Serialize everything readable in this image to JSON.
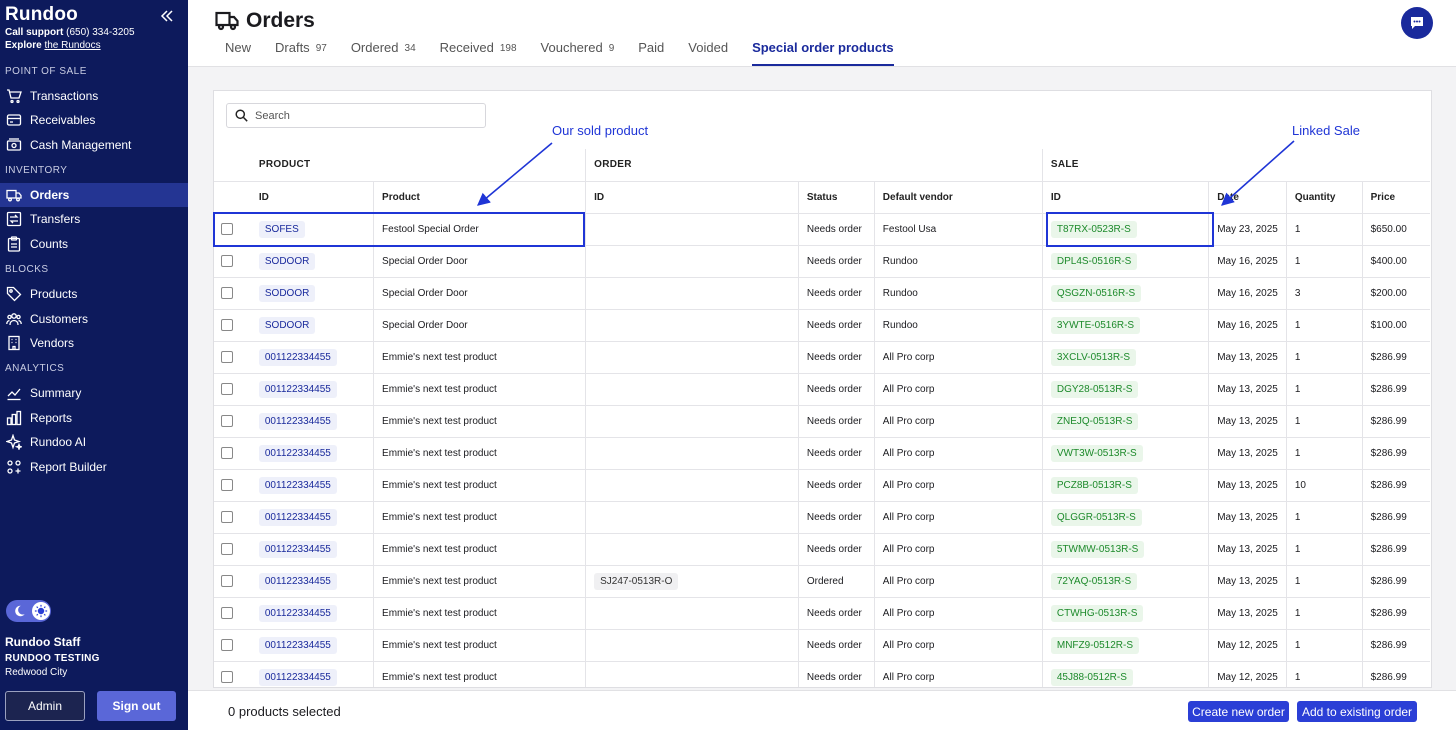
{
  "sidebar": {
    "brand": "Rundoo",
    "support_label": "Call support",
    "support_phone": "(650) 334-3205",
    "explore_label": "Explore",
    "explore_link": "the Rundocs",
    "sections": {
      "pos": "POINT OF SALE",
      "inventory": "INVENTORY",
      "blocks": "BLOCKS",
      "analytics": "ANALYTICS"
    },
    "items": {
      "transactions": "Transactions",
      "receivables": "Receivables",
      "cash": "Cash Management",
      "orders": "Orders",
      "transfers": "Transfers",
      "counts": "Counts",
      "products": "Products",
      "customers": "Customers",
      "vendors": "Vendors",
      "summary": "Summary",
      "reports": "Reports",
      "ai": "Rundoo AI",
      "builder": "Report Builder"
    },
    "user": {
      "name": "Rundoo Staff",
      "org": "RUNDOO TESTING",
      "city": "Redwood City"
    },
    "admin_label": "Admin",
    "signout_label": "Sign out"
  },
  "header": {
    "title": "Orders",
    "tabs": [
      {
        "label": "New",
        "count": ""
      },
      {
        "label": "Drafts",
        "count": "97"
      },
      {
        "label": "Ordered",
        "count": "34"
      },
      {
        "label": "Received",
        "count": "198"
      },
      {
        "label": "Vouchered",
        "count": "9"
      },
      {
        "label": "Paid",
        "count": ""
      },
      {
        "label": "Voided",
        "count": ""
      },
      {
        "label": "Special order products",
        "count": ""
      }
    ]
  },
  "search": {
    "placeholder": "Search"
  },
  "annotations": {
    "sold": "Our sold product",
    "linked": "Linked Sale"
  },
  "table": {
    "groups": {
      "product": "PRODUCT",
      "order": "ORDER",
      "sale": "SALE"
    },
    "columns": {
      "product_id": "ID",
      "product": "Product",
      "order_id": "ID",
      "status": "Status",
      "vendor": "Default vendor",
      "sale_id": "ID",
      "date": "Date",
      "quantity": "Quantity",
      "price": "Price"
    },
    "rows": [
      {
        "pid": "SOFES",
        "product": "Festool Special Order",
        "oid": "",
        "status": "Needs order",
        "vendor": "Festool Usa",
        "sid": "T87RX-0523R-S",
        "date": "May 23, 2025",
        "qty": "1",
        "price": "$650.00"
      },
      {
        "pid": "SODOOR",
        "product": "Special Order Door",
        "oid": "",
        "status": "Needs order",
        "vendor": "Rundoo",
        "sid": "DPL4S-0516R-S",
        "date": "May 16, 2025",
        "qty": "1",
        "price": "$400.00"
      },
      {
        "pid": "SODOOR",
        "product": "Special Order Door",
        "oid": "",
        "status": "Needs order",
        "vendor": "Rundoo",
        "sid": "QSGZN-0516R-S",
        "date": "May 16, 2025",
        "qty": "3",
        "price": "$200.00"
      },
      {
        "pid": "SODOOR",
        "product": "Special Order Door",
        "oid": "",
        "status": "Needs order",
        "vendor": "Rundoo",
        "sid": "3YWTE-0516R-S",
        "date": "May 16, 2025",
        "qty": "1",
        "price": "$100.00"
      },
      {
        "pid": "001122334455",
        "product": "Emmie's next test product",
        "oid": "",
        "status": "Needs order",
        "vendor": "All Pro corp",
        "sid": "3XCLV-0513R-S",
        "date": "May 13, 2025",
        "qty": "1",
        "price": "$286.99"
      },
      {
        "pid": "001122334455",
        "product": "Emmie's next test product",
        "oid": "",
        "status": "Needs order",
        "vendor": "All Pro corp",
        "sid": "DGY28-0513R-S",
        "date": "May 13, 2025",
        "qty": "1",
        "price": "$286.99"
      },
      {
        "pid": "001122334455",
        "product": "Emmie's next test product",
        "oid": "",
        "status": "Needs order",
        "vendor": "All Pro corp",
        "sid": "ZNEJQ-0513R-S",
        "date": "May 13, 2025",
        "qty": "1",
        "price": "$286.99"
      },
      {
        "pid": "001122334455",
        "product": "Emmie's next test product",
        "oid": "",
        "status": "Needs order",
        "vendor": "All Pro corp",
        "sid": "VWT3W-0513R-S",
        "date": "May 13, 2025",
        "qty": "1",
        "price": "$286.99"
      },
      {
        "pid": "001122334455",
        "product": "Emmie's next test product",
        "oid": "",
        "status": "Needs order",
        "vendor": "All Pro corp",
        "sid": "PCZ8B-0513R-S",
        "date": "May 13, 2025",
        "qty": "10",
        "price": "$286.99"
      },
      {
        "pid": "001122334455",
        "product": "Emmie's next test product",
        "oid": "",
        "status": "Needs order",
        "vendor": "All Pro corp",
        "sid": "QLGGR-0513R-S",
        "date": "May 13, 2025",
        "qty": "1",
        "price": "$286.99"
      },
      {
        "pid": "001122334455",
        "product": "Emmie's next test product",
        "oid": "",
        "status": "Needs order",
        "vendor": "All Pro corp",
        "sid": "5TWMW-0513R-S",
        "date": "May 13, 2025",
        "qty": "1",
        "price": "$286.99"
      },
      {
        "pid": "001122334455",
        "product": "Emmie's next test product",
        "oid": "SJ247-0513R-O",
        "status": "Ordered",
        "vendor": "All Pro corp",
        "sid": "72YAQ-0513R-S",
        "date": "May 13, 2025",
        "qty": "1",
        "price": "$286.99"
      },
      {
        "pid": "001122334455",
        "product": "Emmie's next test product",
        "oid": "",
        "status": "Needs order",
        "vendor": "All Pro corp",
        "sid": "CTWHG-0513R-S",
        "date": "May 13, 2025",
        "qty": "1",
        "price": "$286.99"
      },
      {
        "pid": "001122334455",
        "product": "Emmie's next test product",
        "oid": "",
        "status": "Needs order",
        "vendor": "All Pro corp",
        "sid": "MNFZ9-0512R-S",
        "date": "May 12, 2025",
        "qty": "1",
        "price": "$286.99"
      },
      {
        "pid": "001122334455",
        "product": "Emmie's next test product",
        "oid": "",
        "status": "Needs order",
        "vendor": "All Pro corp",
        "sid": "45J88-0512R-S",
        "date": "May 12, 2025",
        "qty": "1",
        "price": "$286.99"
      }
    ]
  },
  "footer": {
    "selected": "0 products selected",
    "create_label": "Create new order",
    "add_label": "Add to existing order"
  },
  "colors": {
    "sidebar": "#0d1a5c",
    "accent": "#1a2a9c",
    "button": "#2b3fd6",
    "sale_green": "#1d8a2b",
    "annotation": "#1f35d6"
  }
}
